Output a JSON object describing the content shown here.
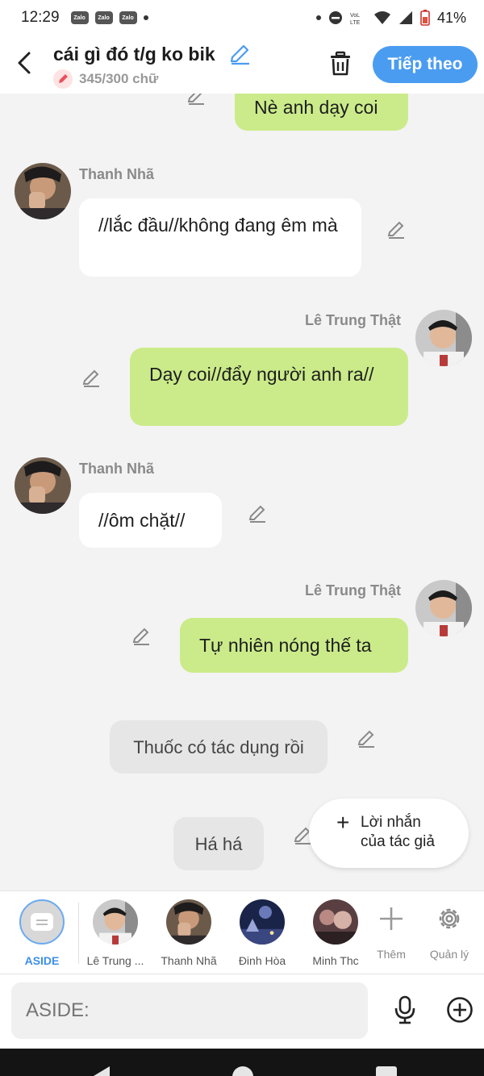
{
  "status_bar": {
    "time": "12:29",
    "app_chip": "Zalo",
    "battery": "41%"
  },
  "header": {
    "title": "cái gì đó t/g ko bik",
    "char_count": "345/300 chữ",
    "next_label": "Tiếp theo"
  },
  "chat": {
    "msg0_text": "Nè anh dạy coi",
    "msg1_sender": "Thanh Nhã",
    "msg1_text": "//lắc đầu//không đang êm mà",
    "msg2_sender": "Lê Trung Thật",
    "msg2_text": "Dạy coi//đẩy người anh ra//",
    "msg3_sender": "Thanh Nhã",
    "msg3_text": "//ôm chặt//",
    "msg4_sender": "Lê Trung Thật",
    "msg4_text": "Tự nhiên nóng thế ta",
    "aside1_text": "Thuốc có tác dụng rồi",
    "aside2_text": "Há há"
  },
  "fab": {
    "line1": "Lời nhắn",
    "line2": "của tác giả"
  },
  "characters": [
    {
      "name": "ASIDE"
    },
    {
      "name": "Lê Trung ..."
    },
    {
      "name": "Thanh Nhã"
    },
    {
      "name": "Đinh Hòa"
    },
    {
      "name": "Minh Thc"
    }
  ],
  "tools": {
    "add_label": "Thêm",
    "manage_label": "Quản lý"
  },
  "input": {
    "placeholder": "ASIDE:"
  },
  "colors": {
    "accent": "#4a9cf1",
    "outgoing_bubble": "#cbeb8a",
    "incoming_bubble": "#ffffff",
    "aside_bubble": "#e6e6e6"
  }
}
